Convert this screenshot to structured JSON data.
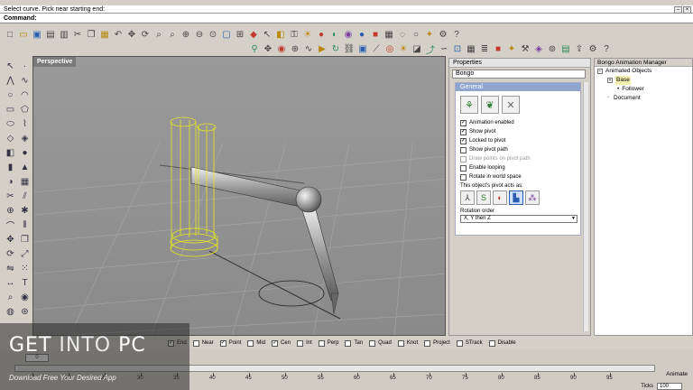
{
  "command": {
    "history": "Select curve. Pick near starting end:",
    "prompt": "Command:"
  },
  "viewport": {
    "title": "Perspective"
  },
  "properties": {
    "title": "Properties",
    "selected": "Bongo",
    "section": "General",
    "checkboxes": [
      {
        "label": "Animation enabled",
        "checked": true,
        "disabled": false
      },
      {
        "label": "Show pivot",
        "checked": true,
        "disabled": false
      },
      {
        "label": "Locked to pivot",
        "checked": true,
        "disabled": false
      },
      {
        "label": "Show pivot path",
        "checked": false,
        "disabled": false
      },
      {
        "label": "Draw points on pivot path",
        "checked": false,
        "disabled": true
      },
      {
        "label": "Enable looping",
        "checked": false,
        "disabled": false
      },
      {
        "label": "Rotate in world space",
        "checked": false,
        "disabled": false
      }
    ],
    "pivot_label": "This object's pivot acts as:",
    "rotation_label": "Rotation order",
    "rotation_value": "X, Y then Z"
  },
  "anim_manager": {
    "title": "Bongo Animation Manager",
    "root": "Animated Objects",
    "base": "Base",
    "follower": "Follower",
    "document": "Document"
  },
  "osnap": [
    {
      "label": "End",
      "checked": true
    },
    {
      "label": "Near",
      "checked": false
    },
    {
      "label": "Point",
      "checked": true
    },
    {
      "label": "Mid",
      "checked": false
    },
    {
      "label": "Cen",
      "checked": true
    },
    {
      "label": "Int",
      "checked": false
    },
    {
      "label": "Perp",
      "checked": false
    },
    {
      "label": "Tan",
      "checked": false
    },
    {
      "label": "Quad",
      "checked": false
    },
    {
      "label": "Knot",
      "checked": false
    },
    {
      "label": "Project",
      "checked": false
    },
    {
      "label": "STrack",
      "checked": false
    },
    {
      "label": "Disable",
      "checked": false
    }
  ],
  "timeline": {
    "frame": "0",
    "ruler_labels": [
      "10",
      "20",
      "25",
      "30",
      "35",
      "40",
      "45",
      "50",
      "55",
      "60",
      "65",
      "70",
      "75",
      "80",
      "85",
      "90",
      "95"
    ],
    "animate_label": "Animate",
    "ticks_label": "Ticks",
    "ticks_value": "100"
  },
  "watermark": {
    "title_a": "GET ",
    "title_b": "INTO",
    "title_c": " PC",
    "subtitle": "Download Free Your Desired App"
  }
}
